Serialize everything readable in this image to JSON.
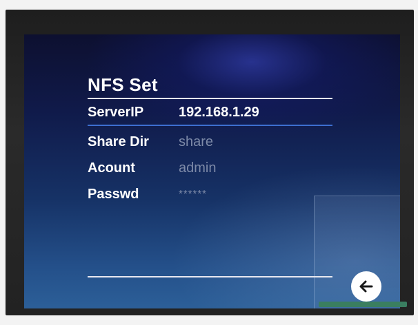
{
  "screen": {
    "title": "NFS Set",
    "fields": {
      "server_ip": {
        "label": "ServerIP",
        "value": "192.168.1.29"
      },
      "share_dir": {
        "label": "Share Dir",
        "value": "share"
      },
      "account": {
        "label": "Acount",
        "value": "admin"
      },
      "password": {
        "label": "Passwd",
        "value": "******"
      }
    },
    "back_button": {
      "icon": "arrow-left-icon"
    }
  },
  "colors": {
    "text_primary": "#ffffff",
    "text_dim": "#7d8aa8",
    "focus_underline": "#3d6fd0",
    "screen_background": "#163266"
  }
}
